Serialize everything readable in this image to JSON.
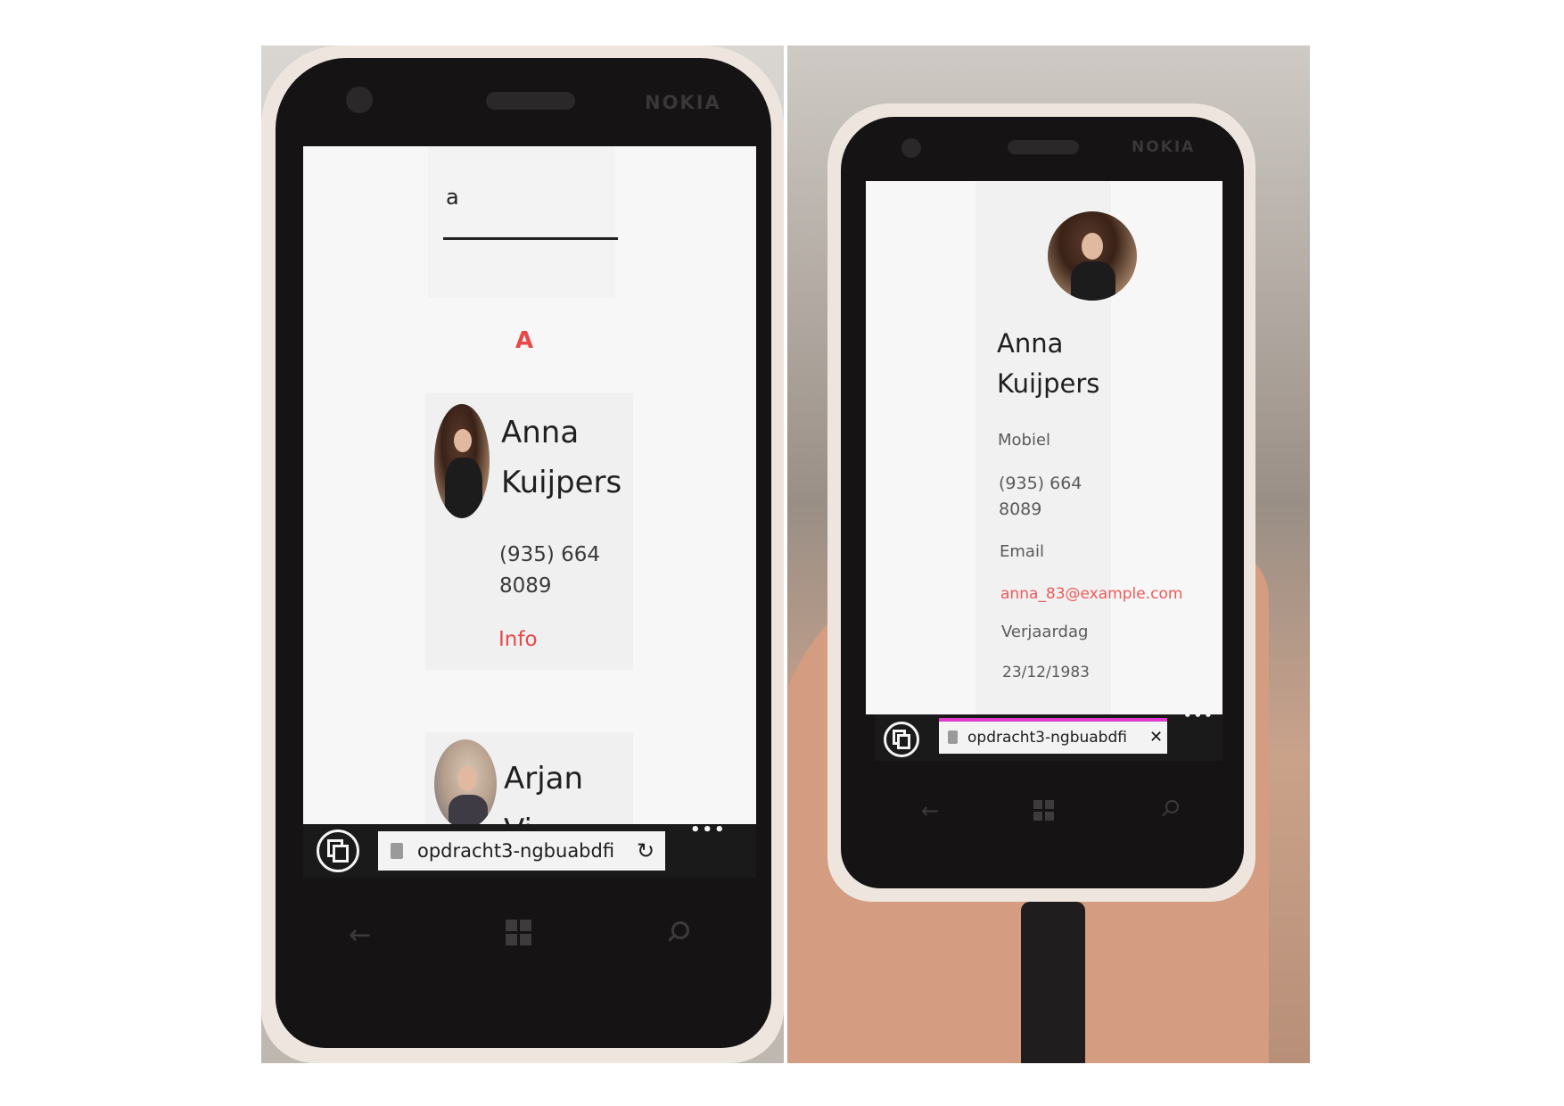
{
  "device_brand": "NOKIA",
  "left_screen": {
    "search_value": "a",
    "section_letter": "A",
    "contacts": [
      {
        "first_name": "Anna",
        "last_name": "Kuijpers",
        "phone_line1": "(935) 664",
        "phone_line2": "8089",
        "link": "Info"
      },
      {
        "first_name": "Arjan",
        "last_name": "Vi"
      }
    ],
    "browser": {
      "url": "opdracht3-ngbuabdfi",
      "more": "•••"
    }
  },
  "right_screen": {
    "first_name": "Anna",
    "last_name": "Kuijpers",
    "mobile_label": "Mobiel",
    "mobile_line1": "(935) 664",
    "mobile_line2": "8089",
    "email_label": "Email",
    "email_value": "anna_83@example.com",
    "birthday_label": "Verjaardag",
    "birthday_value": "23/12/1983",
    "browser": {
      "url": "opdracht3-ngbuabdfi",
      "close": "✕",
      "more": "•••"
    }
  },
  "colors": {
    "accent": "#e84848",
    "email": "#ef5a5a",
    "loading_bar": "#e03bd0",
    "screen_bg": "#f7f7f7"
  },
  "icons": {
    "back": "back-arrow-icon",
    "home": "windows-logo-icon",
    "search": "search-icon",
    "tabs": "tabs-icon",
    "lock": "lock-icon",
    "refresh": "refresh-icon"
  }
}
